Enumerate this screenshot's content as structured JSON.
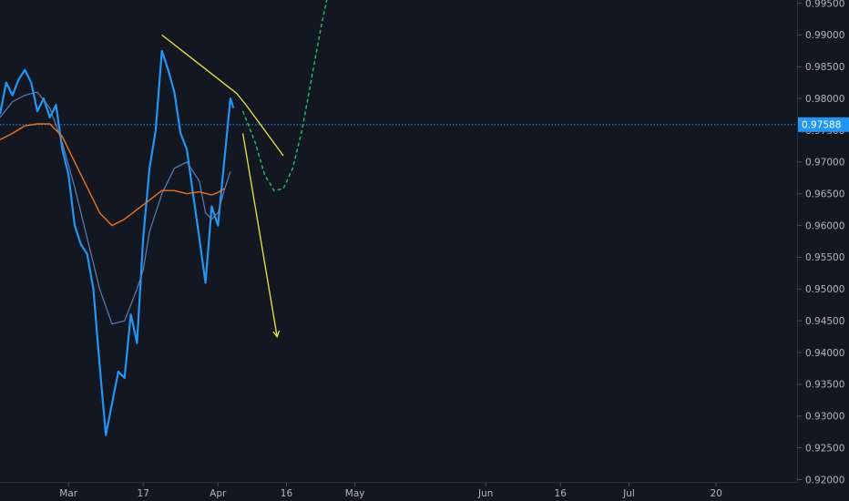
{
  "chart_data": {
    "type": "line",
    "title": "",
    "xlabel": "",
    "ylabel": "",
    "ylim": [
      0.9195,
      0.9955
    ],
    "x_range_days": [
      0,
      128
    ],
    "y_ticks": [
      "0.99500",
      "0.99000",
      "0.98500",
      "0.98000",
      "0.97500",
      "0.97000",
      "0.96500",
      "0.96000",
      "0.95500",
      "0.95000",
      "0.94500",
      "0.94000",
      "0.93500",
      "0.93000",
      "0.92500",
      "0.92000"
    ],
    "x_ticks": [
      {
        "label": "Mar",
        "day": 11
      },
      {
        "label": "17",
        "day": 23
      },
      {
        "label": "Apr",
        "day": 35
      },
      {
        "label": "16",
        "day": 46
      },
      {
        "label": "May",
        "day": 57
      },
      {
        "label": "Jun",
        "day": 78
      },
      {
        "label": "16",
        "day": 90
      },
      {
        "label": "Jul",
        "day": 101
      },
      {
        "label": "20",
        "day": 115
      }
    ],
    "current_price": {
      "label": "0.97588",
      "value": 0.97588,
      "color": "#2196f3"
    },
    "series": [
      {
        "kind": "price",
        "color": "#2196f3",
        "points": [
          [
            0,
            0.9775
          ],
          [
            1,
            0.9825
          ],
          [
            2,
            0.9805
          ],
          [
            3,
            0.983
          ],
          [
            4,
            0.9845
          ],
          [
            5,
            0.9825
          ],
          [
            6,
            0.978
          ],
          [
            7,
            0.98
          ],
          [
            8,
            0.977
          ],
          [
            9,
            0.979
          ],
          [
            10,
            0.972
          ],
          [
            11,
            0.968
          ],
          [
            12,
            0.96
          ],
          [
            13,
            0.957
          ],
          [
            14,
            0.9555
          ],
          [
            15,
            0.95
          ],
          [
            16,
            0.938
          ],
          [
            17,
            0.927
          ],
          [
            18,
            0.932
          ],
          [
            19,
            0.937
          ],
          [
            20,
            0.936
          ],
          [
            21,
            0.946
          ],
          [
            22,
            0.9415
          ],
          [
            23,
            0.958
          ],
          [
            24,
            0.969
          ],
          [
            25,
            0.975
          ],
          [
            26,
            0.9875
          ],
          [
            27,
            0.9845
          ],
          [
            28,
            0.981
          ],
          [
            29,
            0.9745
          ],
          [
            30,
            0.972
          ],
          [
            31,
            0.965
          ],
          [
            32,
            0.958
          ],
          [
            33,
            0.951
          ],
          [
            34,
            0.963
          ],
          [
            35,
            0.96
          ],
          [
            36,
            0.97
          ],
          [
            37,
            0.98
          ],
          [
            37.5,
            0.9785
          ]
        ]
      },
      {
        "kind": "ma-fast",
        "color": "#5b7fb5",
        "points": [
          [
            0,
            0.977
          ],
          [
            2,
            0.9795
          ],
          [
            4,
            0.9805
          ],
          [
            6,
            0.981
          ],
          [
            8,
            0.9785
          ],
          [
            10,
            0.973
          ],
          [
            12,
            0.966
          ],
          [
            14,
            0.958
          ],
          [
            16,
            0.95
          ],
          [
            18,
            0.9445
          ],
          [
            20,
            0.945
          ],
          [
            22,
            0.95
          ],
          [
            23,
            0.953
          ],
          [
            24,
            0.959
          ],
          [
            26,
            0.965
          ],
          [
            28,
            0.969
          ],
          [
            30,
            0.97
          ],
          [
            32,
            0.967
          ],
          [
            33,
            0.962
          ],
          [
            34,
            0.961
          ],
          [
            35,
            0.962
          ],
          [
            36,
            0.9655
          ],
          [
            37,
            0.9685
          ]
        ]
      },
      {
        "kind": "ma-slow",
        "color": "#e8741f",
        "points": [
          [
            0,
            0.9735
          ],
          [
            2,
            0.9745
          ],
          [
            4,
            0.9757
          ],
          [
            6,
            0.976
          ],
          [
            8,
            0.976
          ],
          [
            10,
            0.974
          ],
          [
            12,
            0.97
          ],
          [
            14,
            0.966
          ],
          [
            16,
            0.962
          ],
          [
            18,
            0.96
          ],
          [
            20,
            0.961
          ],
          [
            22,
            0.9625
          ],
          [
            24,
            0.964
          ],
          [
            26,
            0.9655
          ],
          [
            28,
            0.9655
          ],
          [
            30,
            0.965
          ],
          [
            32,
            0.9653
          ],
          [
            34,
            0.9648
          ],
          [
            35,
            0.9652
          ],
          [
            36,
            0.9658
          ]
        ]
      },
      {
        "kind": "trendline",
        "color": "#f0e442",
        "points": [
          [
            26,
            0.99
          ],
          [
            38,
            0.9808
          ],
          [
            39.5,
            0.979
          ],
          [
            45.5,
            0.971
          ]
        ]
      },
      {
        "kind": "arrow-down",
        "color": "#f0e442",
        "points": [
          [
            39,
            0.9745
          ],
          [
            44.5,
            0.9425
          ]
        ]
      },
      {
        "kind": "projection",
        "color": "#22c55e",
        "points": [
          [
            39,
            0.978
          ],
          [
            41,
            0.973
          ],
          [
            42.5,
            0.968
          ],
          [
            44,
            0.9655
          ],
          [
            45.5,
            0.9658
          ],
          [
            47,
            0.969
          ],
          [
            48.5,
            0.975
          ],
          [
            50,
            0.983
          ],
          [
            51.5,
            0.991
          ],
          [
            53,
            0.998
          ]
        ]
      }
    ]
  }
}
